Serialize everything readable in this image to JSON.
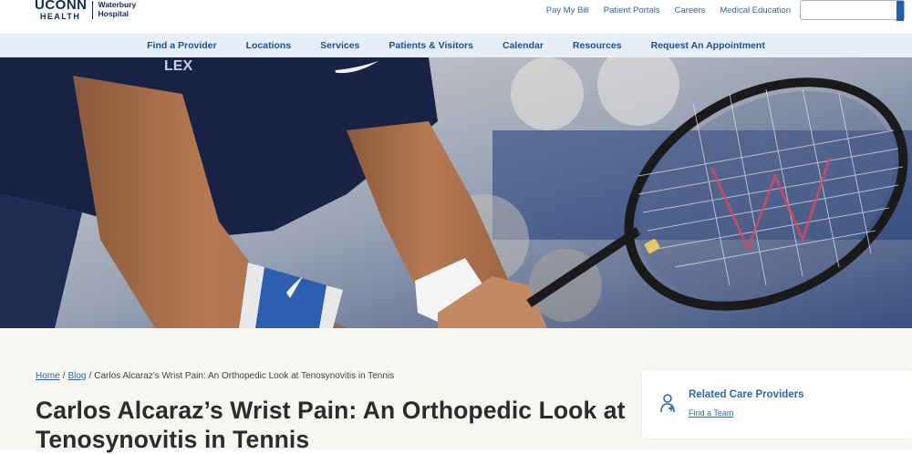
{
  "header": {
    "logo": {
      "brand": "UCONN",
      "sub": "HEALTH",
      "hospital_line1": "Waterbury",
      "hospital_line2": "Hospital"
    },
    "utility_links": [
      "Pay My Bill",
      "Patient Portals",
      "Careers",
      "Medical Education"
    ],
    "search": {
      "placeholder": ""
    }
  },
  "main_nav": [
    "Find a Provider",
    "Locations",
    "Services",
    "Patients & Visitors",
    "Calendar",
    "Resources",
    "Request An Appointment"
  ],
  "hero": {
    "shirt_text": "LEX"
  },
  "breadcrumb": {
    "home": "Home",
    "blog": "Blog",
    "current": "Carlos Alcaraz’s Wrist Pain: An Orthopedic Look at Tenosynovitis in Tennis"
  },
  "article": {
    "title": "Carlos Alcaraz’s Wrist Pain: An Orthopedic Look at Tenosynovitis in Tennis"
  },
  "sidebar_card": {
    "title": "Related Care Providers",
    "link": "Find a Team",
    "icon": "provider-person-icon"
  },
  "colors": {
    "brand_navy": "#0f2a56",
    "link_blue": "#2e67b1",
    "nav_bg": "#e8eef7",
    "content_bg": "#f8f6f3"
  }
}
